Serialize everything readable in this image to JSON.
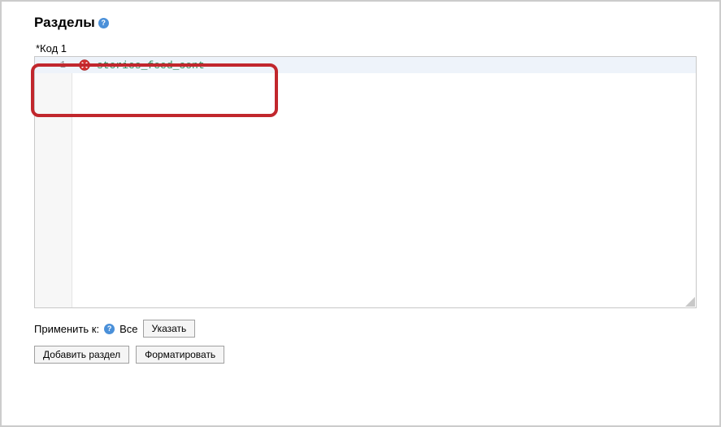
{
  "heading": {
    "title": "Разделы",
    "help_symbol": "?"
  },
  "code_section": {
    "label": "*Код 1",
    "line_number": "1",
    "code": "stories_feed_cont"
  },
  "apply": {
    "label": "Применить к:",
    "help_symbol": "?",
    "all_text": "Все",
    "specify_btn": "Указать"
  },
  "buttons": {
    "add_section": "Добавить раздел",
    "format": "Форматировать"
  }
}
